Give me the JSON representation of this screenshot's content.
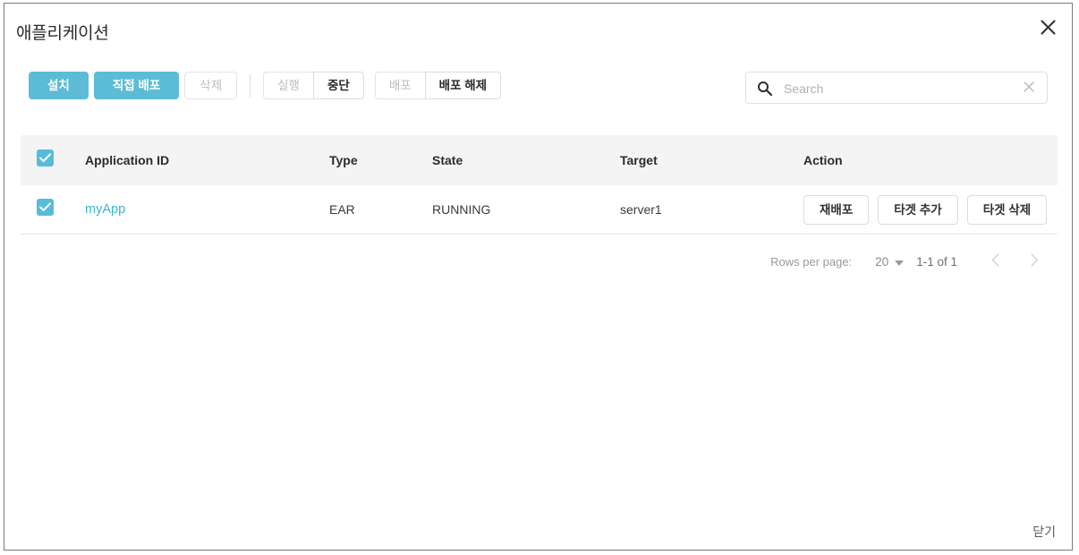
{
  "dialog": {
    "title": "애플리케이션",
    "close_icon": "close-icon",
    "footer_close_label": "닫기"
  },
  "toolbar": {
    "install_label": "설치",
    "direct_deploy_label": "직접 배포",
    "delete_label": "삭제",
    "start_label": "실행",
    "stop_label": "중단",
    "deploy_label": "배포",
    "undeploy_label": "배포 해제"
  },
  "search": {
    "placeholder": "Search",
    "value": "",
    "icon": "search-icon",
    "clear_icon": "close-icon"
  },
  "table": {
    "columns": [
      {
        "key": "appid",
        "label": "Application ID"
      },
      {
        "key": "type",
        "label": "Type"
      },
      {
        "key": "state",
        "label": "State"
      },
      {
        "key": "target",
        "label": "Target"
      },
      {
        "key": "action",
        "label": "Action"
      }
    ],
    "header_checkbox_checked": true,
    "rows": [
      {
        "checked": true,
        "appid": "myApp",
        "type": "EAR",
        "state": "RUNNING",
        "target": "server1",
        "actions": [
          "재배포",
          "타겟 추가",
          "타겟 삭제"
        ]
      }
    ]
  },
  "pagination": {
    "rows_per_page_label": "Rows per page:",
    "rows_per_page_value": "20",
    "range_label": "1-1 of 1",
    "prev_icon": "chevron-left-icon",
    "next_icon": "chevron-right-icon"
  },
  "colors": {
    "accent": "#5cbcd6",
    "link": "#3fb3cf",
    "header_bg": "#f4f4f4"
  }
}
